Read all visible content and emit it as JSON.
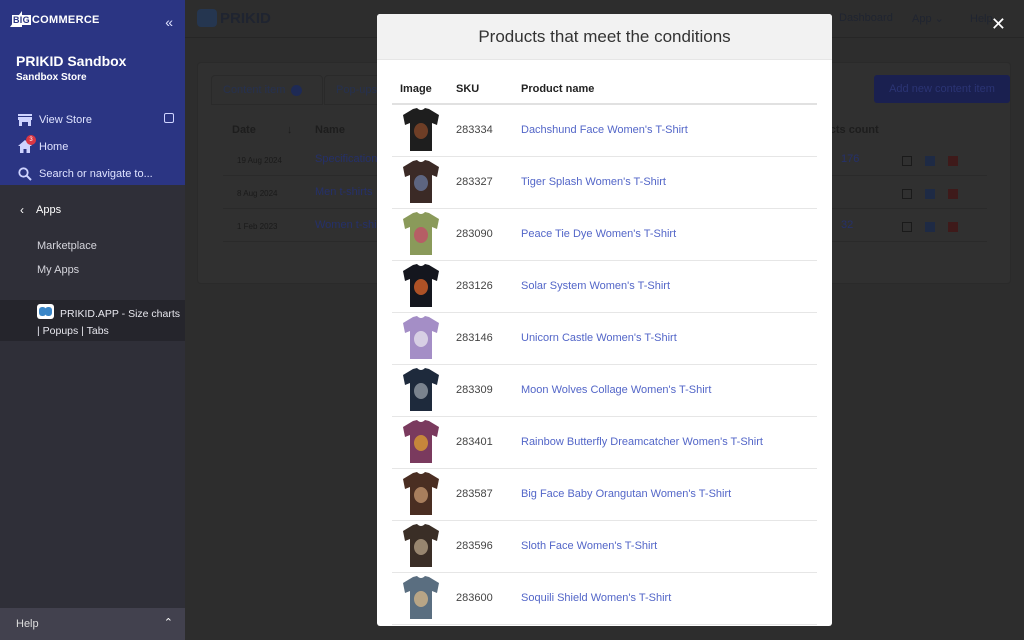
{
  "sidebar": {
    "brand": {
      "big": "BIG",
      "rest": "COMMERCE"
    },
    "collapse_icon": "double-chevron-left-icon",
    "store_name": "PRIKID Sandbox",
    "store_type": "Sandbox Store",
    "nav": [
      {
        "label": "View Store",
        "icon": "storefront-icon"
      },
      {
        "label": "Home",
        "icon": "home-icon",
        "badge": "3"
      },
      {
        "label": "Search or navigate to...",
        "icon": "search-icon"
      }
    ],
    "apps_label": "Apps",
    "sub_items": [
      "Marketplace",
      "My Apps"
    ],
    "app_item": "PRIKID.APP - Size charts | Popups | Tabs",
    "help_label": "Help"
  },
  "app": {
    "logo": "PRIKID",
    "nav": [
      "Dashboard",
      "App",
      "Help"
    ],
    "tabs": [
      "Content item",
      "Pop-ups"
    ],
    "add_button": "Add new content item",
    "columns": [
      "Date",
      "Name",
      "Products count"
    ],
    "rows": [
      {
        "date": "19 Aug 2024",
        "name": "Specification",
        "count": "176"
      },
      {
        "date": "8 Aug 2024",
        "name": "Men t-shirts",
        "count": ""
      },
      {
        "date": "1 Feb 2023",
        "name": "Women t-shirts",
        "count": "32"
      }
    ]
  },
  "modal": {
    "title": "Products that meet the conditions",
    "close_icon": "close-icon",
    "columns": {
      "image": "Image",
      "sku": "SKU",
      "name": "Product name"
    },
    "products": [
      {
        "sku": "283334",
        "name": "Dachshund Face Women's T-Shirt",
        "color": "#1e1e1e",
        "accent": "#8a4a2a"
      },
      {
        "sku": "283327",
        "name": "Tiger Splash Women's T-Shirt",
        "color": "#3b2a26",
        "accent": "#6a7aa0"
      },
      {
        "sku": "283090",
        "name": "Peace Tie Dye Women's T-Shirt",
        "color": "#8a9a5a",
        "accent": "#c44a6a"
      },
      {
        "sku": "283126",
        "name": "Solar System Women's T-Shirt",
        "color": "#14161e",
        "accent": "#e0662a"
      },
      {
        "sku": "283146",
        "name": "Unicorn Castle Women's T-Shirt",
        "color": "#a48ec6",
        "accent": "#e8e4ee"
      },
      {
        "sku": "283309",
        "name": "Moon Wolves Collage Women's T-Shirt",
        "color": "#1e2a3c",
        "accent": "#9aa2aa"
      },
      {
        "sku": "283401",
        "name": "Rainbow Butterfly Dreamcatcher Women's T-Shirt",
        "color": "#7a3a5e",
        "accent": "#e0a030"
      },
      {
        "sku": "283587",
        "name": "Big Face Baby Orangutan Women's T-Shirt",
        "color": "#4a2e22",
        "accent": "#c89a72"
      },
      {
        "sku": "283596",
        "name": "Sloth Face Women's T-Shirt",
        "color": "#3a2e26",
        "accent": "#b8a488"
      },
      {
        "sku": "283600",
        "name": "Soquili Shield Women's T-Shirt",
        "color": "#5a6e80",
        "accent": "#d8b888"
      }
    ]
  }
}
